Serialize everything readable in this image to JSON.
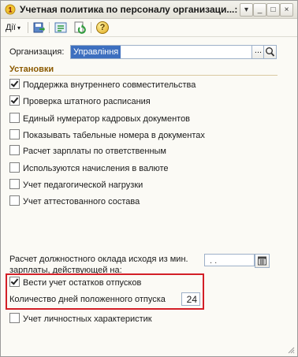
{
  "window": {
    "title": "Учетная политика по персоналу организаци...: ..."
  },
  "titlebar_buttons": [
    {
      "icon": "dropdown-icon",
      "glyph": "▾"
    },
    {
      "icon": "minimize-icon",
      "glyph": "_"
    },
    {
      "icon": "maximize-icon",
      "glyph": "□"
    },
    {
      "icon": "close-icon",
      "glyph": "×"
    }
  ],
  "toolbar": {
    "actions_label": "Дії",
    "actions_arrow": "▾",
    "help_glyph": "?"
  },
  "organization": {
    "label": "Организация:",
    "value": "Управління",
    "select_glyph": "..."
  },
  "settings": {
    "title": "Установки",
    "items": [
      {
        "label": "Поддержка внутреннего совместительства",
        "checked": true
      },
      {
        "label": "Проверка штатного расписания",
        "checked": true
      },
      {
        "label": "Единый нумератор кадровых документов",
        "checked": false
      },
      {
        "label": "Показывать табельные номера в документах",
        "checked": false
      },
      {
        "label": "Расчет зарплаты по ответственным",
        "checked": false
      },
      {
        "label": "Используются начисления в валюте",
        "checked": false
      },
      {
        "label": "Учет педагогической нагрузки",
        "checked": false
      },
      {
        "label": "Учет аттестованного состава",
        "checked": false
      }
    ]
  },
  "salary_calc": {
    "label": "Расчет должностного оклада исходя из мин. зарплаты, действующей на:",
    "date_value": ". ."
  },
  "vacation": {
    "track_label": "Вести учет остатков отпусков",
    "track_checked": true,
    "days_label": "Количество дней положенного отпуска",
    "days_value": "24"
  },
  "personal": {
    "label": "Учет личностных характеристик",
    "checked": false
  },
  "colors": {
    "highlight_frame": "#d31f27",
    "section_title": "#8b5a00",
    "selected_value_bg": "#3d6fbf"
  }
}
